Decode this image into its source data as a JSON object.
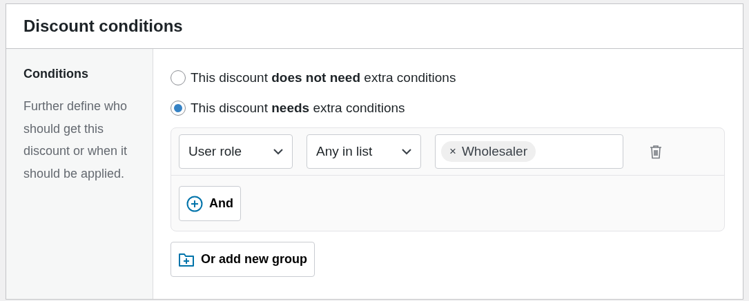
{
  "panel": {
    "title": "Discount conditions"
  },
  "sidebar": {
    "heading": "Conditions",
    "description": "Further define who should get this discount or when it should be applied."
  },
  "options": [
    {
      "label": "This discount **does not need** extra conditions",
      "selected": false
    },
    {
      "label": "This discount **needs** extra conditions",
      "selected": true
    }
  ],
  "group": {
    "conditions": [
      {
        "field": "User role",
        "operator": "Any in list",
        "tags": [
          {
            "remove": "×",
            "label": "Wholesaler"
          }
        ]
      }
    ],
    "and_button": "And"
  },
  "add_group_button": "Or add new group"
}
